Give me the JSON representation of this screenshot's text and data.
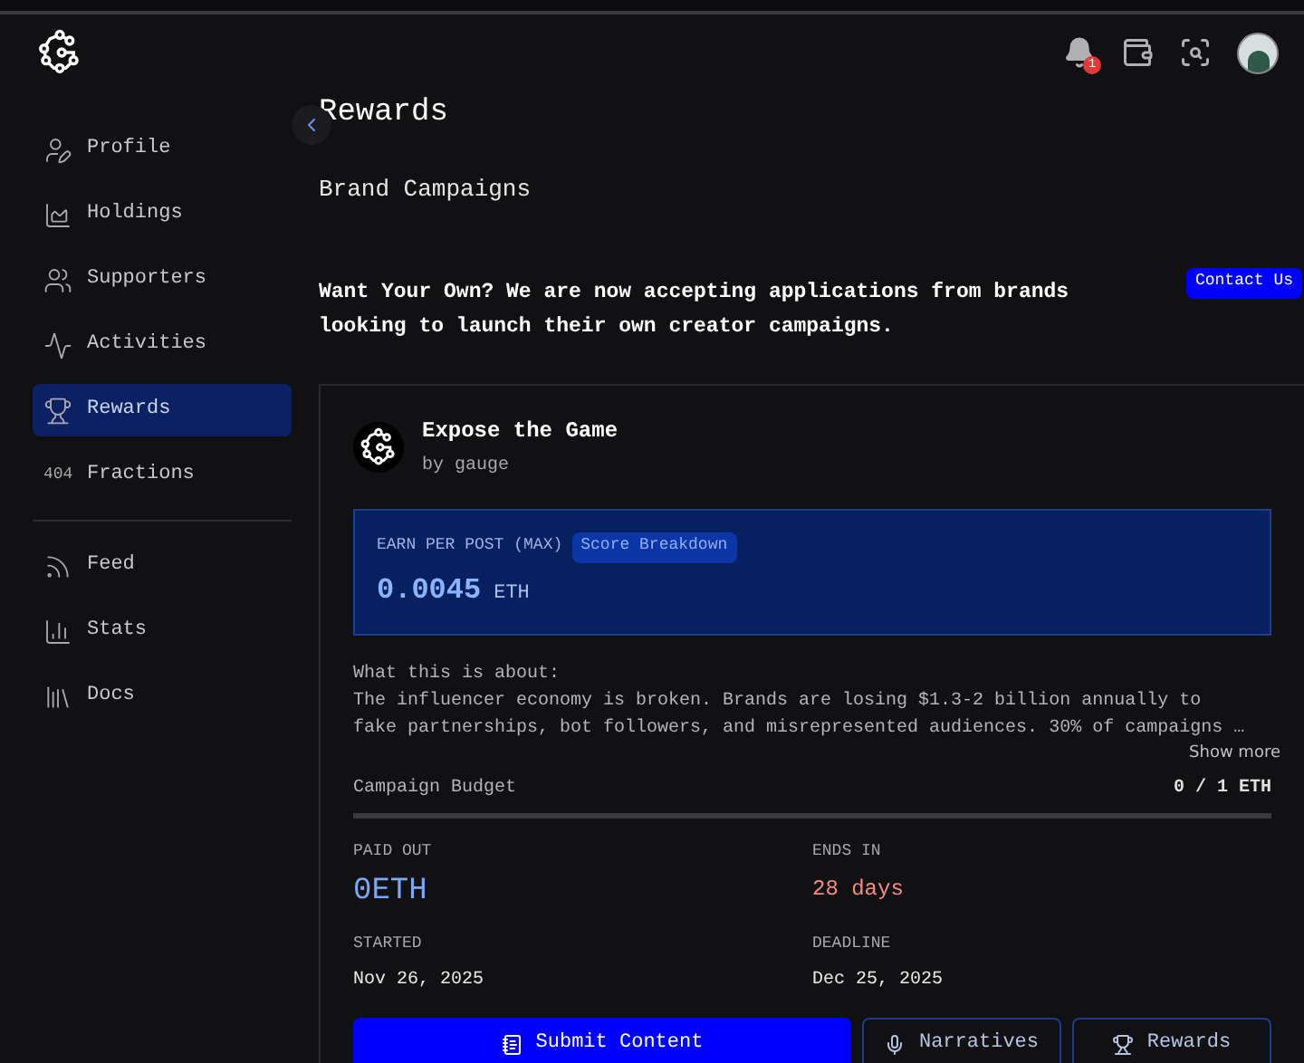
{
  "header": {
    "notification_count": "1"
  },
  "sidebar": {
    "items": [
      {
        "kind": "icon",
        "label": "Profile",
        "selected": false
      },
      {
        "kind": "icon",
        "label": "Holdings",
        "selected": false
      },
      {
        "kind": "icon",
        "label": "Supporters",
        "selected": false
      },
      {
        "kind": "icon",
        "label": "Activities",
        "selected": false
      },
      {
        "kind": "icon",
        "label": "Rewards",
        "selected": true
      },
      {
        "kind": "glyph",
        "glyph": "404",
        "label": "Fractions",
        "selected": false
      }
    ],
    "secondary_items": [
      {
        "label": "Feed",
        "selected": false
      },
      {
        "label": "Stats",
        "selected": false
      },
      {
        "label": "Docs",
        "selected": false
      }
    ]
  },
  "page": {
    "title": "Rewards",
    "subtitle": "Brand Campaigns",
    "cta_text": "Want Your Own? We are now accepting applications from brands looking to launch their own creator campaigns.",
    "cta_button": "Contact Us"
  },
  "campaign": {
    "title": "Expose the Game",
    "author": "by gauge",
    "earn_label": "EARN PER POST (MAX)",
    "score_button": "Score Breakdown",
    "earn_value": "0.0045",
    "earn_unit": "ETH",
    "about_label": "What this is about:",
    "about_lines": [
      "The influencer economy is broken. Brands are losing $1.3-2 billion annually to",
      "fake partnerships, bot followers, and misrepresented audiences. 30% of campaigns …"
    ],
    "show_more": "Show more",
    "budget_label": "Campaign Budget",
    "budget_value": "0 / 1 ETH",
    "budget": {
      "level": 0
    },
    "stats": [
      {
        "label": "PAID OUT",
        "value": "0ETH",
        "kind": "amount"
      },
      {
        "label": "ENDS IN",
        "value": "28 days",
        "kind": "warning"
      },
      {
        "label": "STARTED",
        "value": "Nov 26, 2025",
        "kind": "date"
      },
      {
        "label": "DEADLINE",
        "value": "Dec 25, 2025",
        "kind": "date"
      }
    ],
    "actions": [
      {
        "label": "Submit Content",
        "kind": "primary"
      },
      {
        "label": "Narratives",
        "kind": "outline"
      },
      {
        "label": "Rewards",
        "kind": "outline"
      }
    ]
  }
}
